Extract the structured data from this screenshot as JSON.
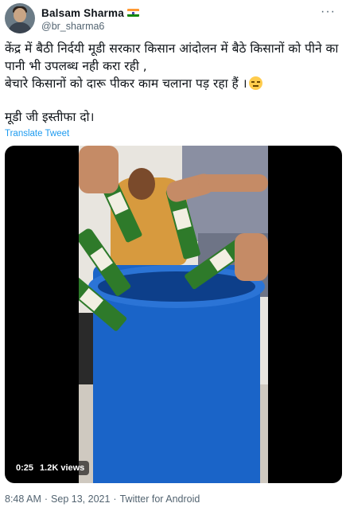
{
  "author": {
    "display_name": "Balsam Sharma",
    "handle": "@br_sharma6",
    "flag_icon": "india-flag-icon",
    "avatar_icon": "user-avatar"
  },
  "menu": {
    "more_icon": "more-horizontal-icon",
    "more_glyph": "···"
  },
  "tweet": {
    "line1": "केंद्र में बैठी निर्दयी मूडी सरकार किसान आंदोलन में बैठे किसानों को पीने का पानी भी उपलब्ध नही करा रही ,",
    "line2": "बेचारे किसानों को दारू पीकर काम चलाना पड़ रहा हैं ।",
    "line2_emoji": "expressionless-face-emoji",
    "line3": "मूडी जी इस्तीफा दो।",
    "translate_label": "Translate Tweet"
  },
  "video": {
    "timestamp": "0:25",
    "views": "1.2K views"
  },
  "footer": {
    "time": "8:48 AM",
    "separator": "·",
    "date": "Sep 13, 2021",
    "separator2": "·",
    "source": "Twitter for Android"
  },
  "colors": {
    "link": "#1d9bf0",
    "muted": "#536471",
    "drum": "#1a64c8"
  }
}
